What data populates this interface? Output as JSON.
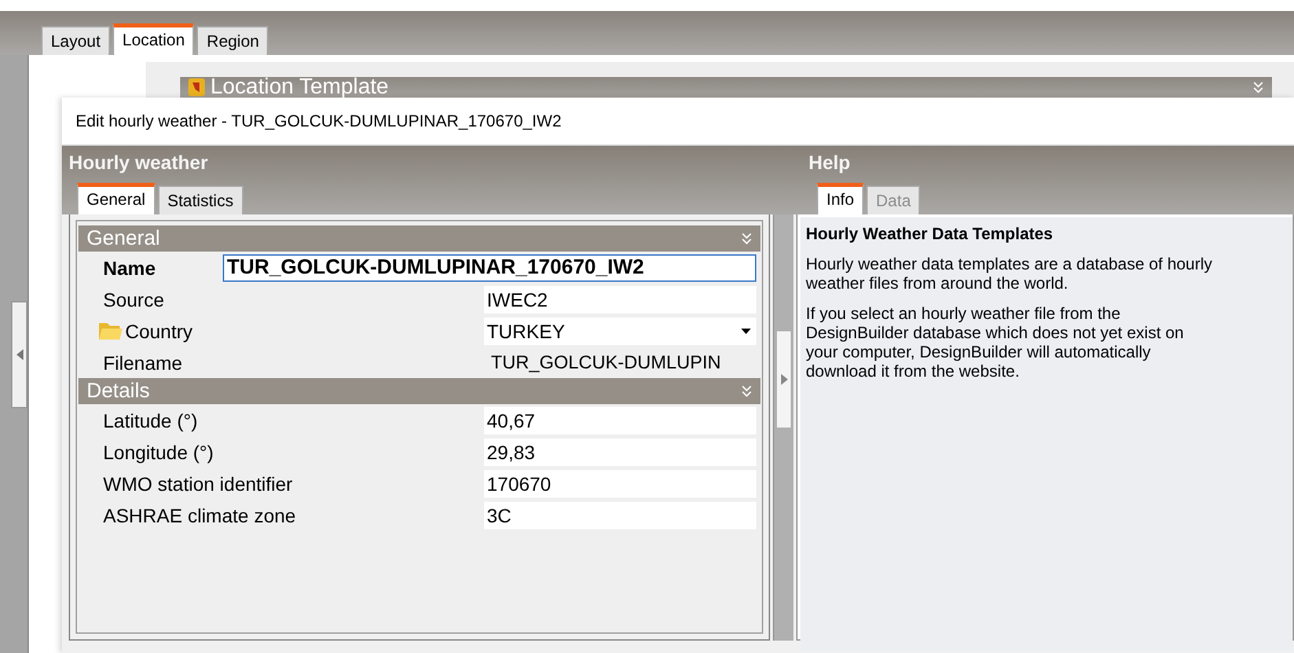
{
  "main_tabs": [
    {
      "label": "Layout",
      "selected": false
    },
    {
      "label": "Location",
      "selected": true
    },
    {
      "label": "Region",
      "selected": false
    }
  ],
  "template_panel": {
    "title": "Location Template"
  },
  "dialog": {
    "title": "Edit hourly weather - TUR_GOLCUK-DUMLUPINAR_170670_IW2",
    "left": {
      "title": "Hourly weather",
      "tabs": [
        {
          "label": "General",
          "selected": true
        },
        {
          "label": "Statistics",
          "selected": false
        }
      ],
      "sections": [
        {
          "title": "General",
          "rows": [
            {
              "kind": "edit",
              "label": "Name",
              "value": "TUR_GOLCUK-DUMLUPINAR_170670_IW2"
            },
            {
              "kind": "field",
              "label": "Source",
              "value": "IWEC2"
            },
            {
              "kind": "dropdown",
              "label": "Country",
              "value": "TURKEY"
            },
            {
              "kind": "plain",
              "label": "Filename",
              "value": "TUR_GOLCUK-DUMLUPIN"
            }
          ]
        },
        {
          "title": "Details",
          "rows": [
            {
              "kind": "field",
              "label": "Latitude (°)",
              "value": "40,67"
            },
            {
              "kind": "field",
              "label": "Longitude (°)",
              "value": "29,83"
            },
            {
              "kind": "field",
              "label": "WMO station identifier",
              "value": "170670"
            },
            {
              "kind": "field",
              "label": "ASHRAE climate zone",
              "value": "3C"
            }
          ]
        }
      ]
    },
    "help": {
      "title": "Help",
      "tabs": [
        {
          "label": "Info",
          "selected": true,
          "disabled": false
        },
        {
          "label": "Data",
          "selected": false,
          "disabled": true
        }
      ],
      "heading": "Hourly Weather Data Templates",
      "paragraphs": [
        "Hourly weather data templates are a database of hourly weather files from around the world.",
        "If you select an hourly weather file from the DesignBuilder database which does not yet exist on your computer, DesignBuilder will automatically download it from the website."
      ]
    }
  }
}
